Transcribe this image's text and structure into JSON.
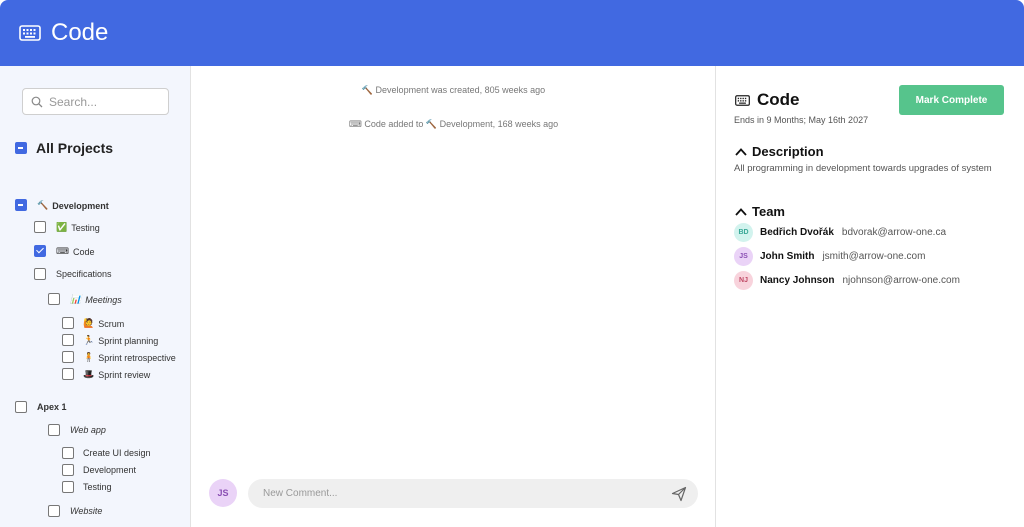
{
  "header": {
    "title": "Code",
    "icon": "keyboard-icon",
    "color": "#4169e1"
  },
  "sidebar": {
    "search_placeholder": "Search...",
    "all_projects": "All Projects",
    "tree": [
      {
        "label": "Development",
        "icon": "🔨",
        "state": "indeterminate",
        "level": 0,
        "bold": true
      },
      {
        "label": "Testing",
        "icon": "✅",
        "state": "unchecked",
        "level": 1
      },
      {
        "label": "Code",
        "icon": "⌨",
        "state": "checked",
        "level": 1
      },
      {
        "label": "Specifications",
        "icon": "",
        "state": "unchecked",
        "level": 1
      },
      {
        "label": "Meetings",
        "icon": "📊",
        "state": "unchecked",
        "level": 2,
        "italic": true
      },
      {
        "label": "Scrum",
        "icon": "🙋",
        "state": "unchecked",
        "level": 3
      },
      {
        "label": "Sprint planning",
        "icon": "🏃",
        "state": "unchecked",
        "level": 3
      },
      {
        "label": "Sprint retrospective",
        "icon": "🧍",
        "state": "unchecked",
        "level": 3
      },
      {
        "label": "Sprint review",
        "icon": "🎩",
        "state": "unchecked",
        "level": 3
      },
      {
        "label": "Apex 1",
        "icon": "",
        "state": "unchecked",
        "level": 0,
        "bold": true
      },
      {
        "label": "Web app",
        "icon": "",
        "state": "unchecked",
        "level": 2,
        "italic": true
      },
      {
        "label": "Create UI design",
        "icon": "",
        "state": "unchecked",
        "level": 3
      },
      {
        "label": "Development",
        "icon": "",
        "state": "unchecked",
        "level": 3
      },
      {
        "label": "Testing",
        "icon": "",
        "state": "unchecked",
        "level": 3
      },
      {
        "label": "Website",
        "icon": "",
        "state": "unchecked",
        "level": 2,
        "italic": true
      }
    ]
  },
  "activity": {
    "items": [
      "🔨 Development was created, 805 weeks ago",
      "⌨ Code added to 🔨 Development, 168 weeks ago"
    ],
    "comment_placeholder": "New Comment...",
    "user_initials": "JS"
  },
  "detail": {
    "title": "Code",
    "ends": "Ends in 9 Months; May 16th 2027",
    "mark_complete": "Mark Complete",
    "description_heading": "Description",
    "description": "All programming in development towards upgrades of system",
    "team_heading": "Team",
    "team": [
      {
        "initials": "BD",
        "name": "Bedřich Dvořák",
        "email": "bdvorak@arrow-one.ca",
        "bg": "#d2f3ee",
        "fg": "#3aa897"
      },
      {
        "initials": "JS",
        "name": "John Smith",
        "email": "jsmith@arrow-one.com",
        "bg": "#ead3f7",
        "fg": "#8a4fb3"
      },
      {
        "initials": "NJ",
        "name": "Nancy Johnson",
        "email": "njohnson@arrow-one.com",
        "bg": "#f8d3dc",
        "fg": "#c04a66"
      }
    ]
  },
  "colors": {
    "accent": "#4169e1",
    "success": "#56c48c",
    "sidebar_bg": "#f3f6fd"
  }
}
